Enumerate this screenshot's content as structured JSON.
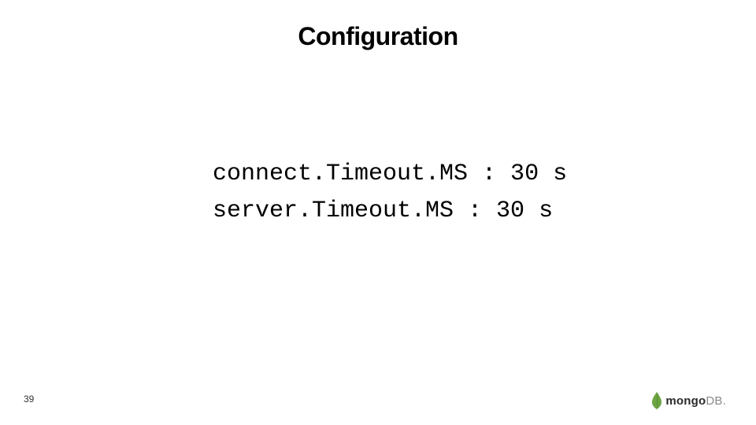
{
  "slide": {
    "title": "Configuration",
    "config_lines": {
      "line1": "connect.Timeout.MS : 30 s",
      "line2": "server.Timeout.MS : 30 s"
    },
    "slide_number": "39"
  },
  "logo": {
    "brand_bold": "mongo",
    "brand_light": "DB.",
    "leaf_color": "#6CA441"
  }
}
